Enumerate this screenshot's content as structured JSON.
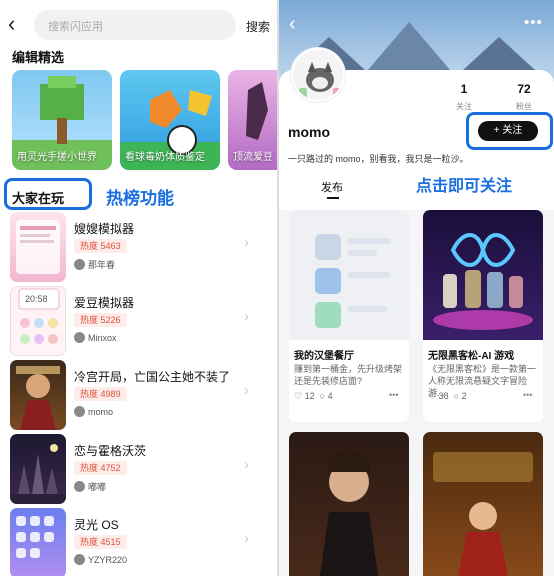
{
  "left": {
    "search_placeholder": "搜索闪应用",
    "search_button": "搜索",
    "section_title": "编辑精选",
    "featured": [
      {
        "caption": "用灵光手搓小世界"
      },
      {
        "caption": "看球毒奶体质鉴定"
      },
      {
        "caption": "顶流爱豆"
      }
    ],
    "everyone_playing": "大家在玩",
    "annotation": "热榜功能",
    "items": [
      {
        "name": "嫂嫂模拟器",
        "heat": "热度 5463",
        "author": "那年春"
      },
      {
        "name": "爱豆模拟器",
        "heat": "热度 5226",
        "author": "Minxox"
      },
      {
        "name": "冷宫开局，亡国公主她不装了",
        "heat": "热度 4989",
        "author": "momo"
      },
      {
        "name": "恋与霍格沃茨",
        "heat": "热度 4752",
        "author": "嘟嘟"
      },
      {
        "name": "灵光 OS",
        "heat": "热度 4515",
        "author": "YZYR220"
      }
    ]
  },
  "right": {
    "more": "•••",
    "stats": [
      {
        "value": "1",
        "label": "关注"
      },
      {
        "value": "72",
        "label": "粉丝"
      }
    ],
    "username": "momo",
    "follow_button": "+ 关注",
    "bio": "一只路过的 momo，别看我，我只是一粒沙。",
    "tab": "发布",
    "annotation": "点击即可关注",
    "posts": [
      {
        "title": "我的汉堡餐厅",
        "desc": "赚到第一桶金，先升级烤架还是先装修店面?",
        "likes": "12",
        "comments": "4"
      },
      {
        "title": "无限黑客松-AI 游戏",
        "desc": "《无限黑客松》是一款第一人称无限流悬疑文字冒险游...",
        "likes": "38",
        "comments": "2"
      }
    ]
  },
  "colors": {
    "accent": "#1a6fe0",
    "heat": "#e0533d"
  }
}
